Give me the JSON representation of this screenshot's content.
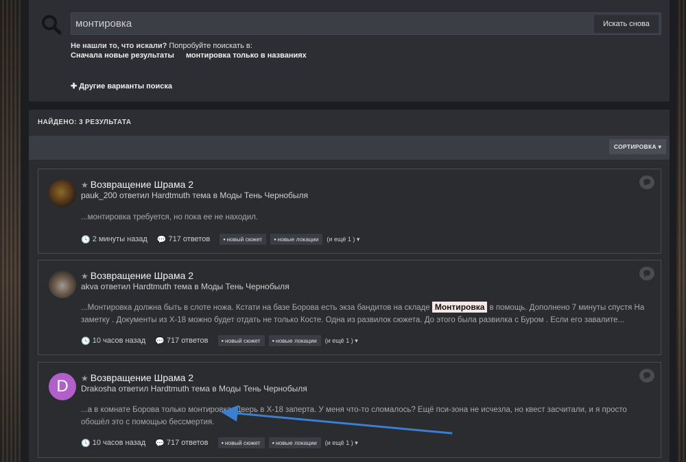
{
  "search": {
    "query": "монтировка",
    "button_label": "Искать снова",
    "notfound_bold": "Не нашли то, что искали?",
    "notfound_rest": " Попробуйте поискать в:",
    "alt_newest": "Сначала новые результаты",
    "alt_titles": "монтировка только в названиях",
    "more_options": "Другие варианты поиска"
  },
  "results": {
    "found_label": "НАЙДЕНО: 3 РЕЗУЛЬТАТА",
    "sort_label": "СОРТИРОВКА",
    "items": [
      {
        "title": "Возвращение Шрама 2",
        "byline": "pauk_200 ответил Hardtmuth тема в Моды Тень Чернобыля",
        "snippet": "...монтировка требуется, но пока ее не находил.",
        "time": "2 минуты назад",
        "replies": "717 ответов",
        "tag1": "новый сюжет",
        "tag2": "новые локации",
        "more": "(и ещё 1 )"
      },
      {
        "title": "Возвращение Шрама 2",
        "byline": "akva ответил Hardtmuth тема в Моды Тень Чернобыля",
        "snippet_before": "...Монтировка должна быть в слоте ножа. Кстати на базе Борова есть экза бандитов на складе ",
        "snippet_highlight": "Монтировка",
        "snippet_after": " в помощь. Дополнено 7 минуты спустя На заметку . Документы из Х-18 можно будет отдать не только Косте. Одна из развилок сюжета. До этого была развилка с Буром . Если его завалите...",
        "time": "10 часов назад",
        "replies": "717 ответов",
        "tag1": "новый сюжет",
        "tag2": "новые локации",
        "more": "(и ещё 1 )"
      },
      {
        "avatar_letter": "D",
        "title": "Возвращение Шрама 2",
        "byline": "Drakosha ответил Hardtmuth тема в Моды Тень Чернобыля",
        "snippet": "...а в комнате Борова только монтировка. Дверь в Х-18 заперта. У меня что-то сломалось? Ещё пси-зона не исчезла, но квест засчитали, и я просто обошёл это с помощью бессмертия.",
        "time": "10 часов назад",
        "replies": "717 ответов",
        "tag1": "новый сюжет",
        "tag2": "новые локации",
        "more": "(и ещё 1 )"
      }
    ]
  },
  "colors": {
    "panel": "#2c2e33",
    "accent_arrow": "#3b7fd1",
    "avatar_letter_bg": "#b060c8"
  }
}
